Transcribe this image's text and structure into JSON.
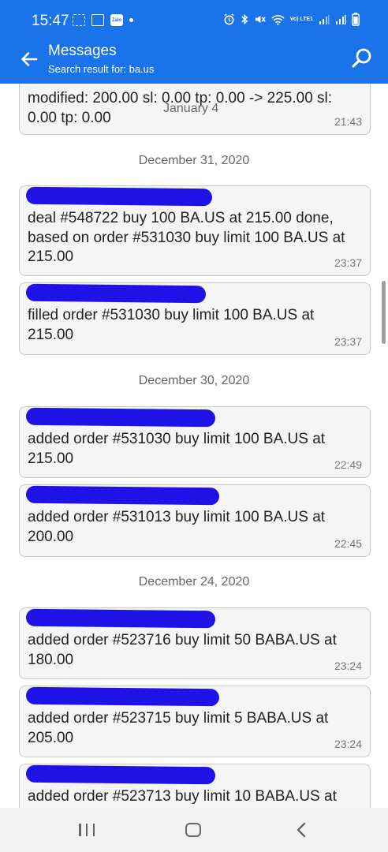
{
  "status_bar": {
    "time": "15:47",
    "left_icons": [
      "screenshot-icon",
      "gallery-icon",
      "zalo-icon",
      "notification-dot-icon"
    ],
    "right_icons": [
      "alarm-icon",
      "bluetooth-icon",
      "mute-icon",
      "wifi-icon",
      "volte-icon",
      "signal-icon",
      "signal-icon",
      "battery-icon"
    ],
    "volte_label": "Vo) LTE1"
  },
  "app_bar": {
    "title": "Messages",
    "subtitle": "Search result for: ba.us",
    "back_icon": "arrow-left-icon",
    "search_icon": "search-icon"
  },
  "list": {
    "overlay_date": "January 4",
    "cards": [
      {
        "body": "modified: 200.00 sl: 0.00 tp: 0.00 -> 225.00 sl: 0.00 tp: 0.00",
        "time": "21:43",
        "sender_redacted": false
      },
      {
        "body": "deal #548722 buy 100 BA.US at 215.00 done, based on order #531030 buy limit 100 BA.US at 215.00",
        "time": "23:37",
        "sender_redacted": true
      },
      {
        "body": "filled order #531030 buy limit 100 BA.US at 215.00",
        "time": "23:37",
        "sender_redacted": true
      },
      {
        "body": "added order #531030 buy limit 100 BA.US at 215.00",
        "time": "22:49",
        "sender_redacted": true
      },
      {
        "body": "added order #531013 buy limit 100 BA.US at 200.00",
        "time": "22:45",
        "sender_redacted": true
      },
      {
        "body": "added order #523716 buy limit 50 BABA.US at 180.00",
        "time": "23:24",
        "sender_redacted": true
      },
      {
        "body": "added order #523715 buy limit 5 BABA.US at 205.00",
        "time": "23:24",
        "sender_redacted": true
      },
      {
        "body": "added order #523713 buy limit 10 BABA.US at",
        "time": "",
        "sender_redacted": true
      }
    ],
    "date_separators": [
      "December 31, 2020",
      "December 30, 2020",
      "December 24, 2020"
    ]
  },
  "nav_bar": {
    "recents_icon": "recents-icon",
    "home_icon": "home-icon",
    "back_icon": "back-chevron-icon"
  },
  "colors": {
    "accent": "#1a73e8",
    "redaction": "#1e12e6",
    "card_bg": "#f5f5f5"
  }
}
